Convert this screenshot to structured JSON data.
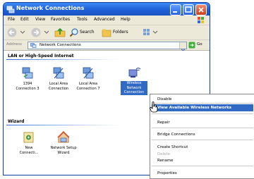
{
  "window": {
    "title": "Network Connections"
  },
  "menubar": [
    "File",
    "Edit",
    "View",
    "Favorites",
    "Tools",
    "Advanced",
    "Help"
  ],
  "toolbar": {
    "search_label": "Search",
    "folders_label": "Folders"
  },
  "address": {
    "label": "Address",
    "value": "Network Connections",
    "go_label": "Go"
  },
  "sections": {
    "lan_title": "LAN or High-Speed Internet",
    "lan_items": [
      {
        "label1": "1394",
        "label2": "Connection 3"
      },
      {
        "label1": "Local Area",
        "label2": "Connection"
      },
      {
        "label1": "Local Area",
        "label2": "Connection 7"
      },
      {
        "label1": "Wireless",
        "label2": "Network",
        "label3": "Connection"
      }
    ],
    "wizard_title": "Wizard",
    "wizard_items": [
      {
        "label1": "New",
        "label2": "Connecti..."
      },
      {
        "label1": "Network Setup",
        "label2": "Wizard"
      }
    ]
  },
  "context_menu": {
    "disable": "Disable",
    "view_wireless": "View Available Wireless Networks",
    "repair": "Repair",
    "bridge": "Bridge Connections",
    "shortcut": "Create Shortcut",
    "delete": "Delete",
    "rename": "Rename",
    "properties": "Properties"
  }
}
